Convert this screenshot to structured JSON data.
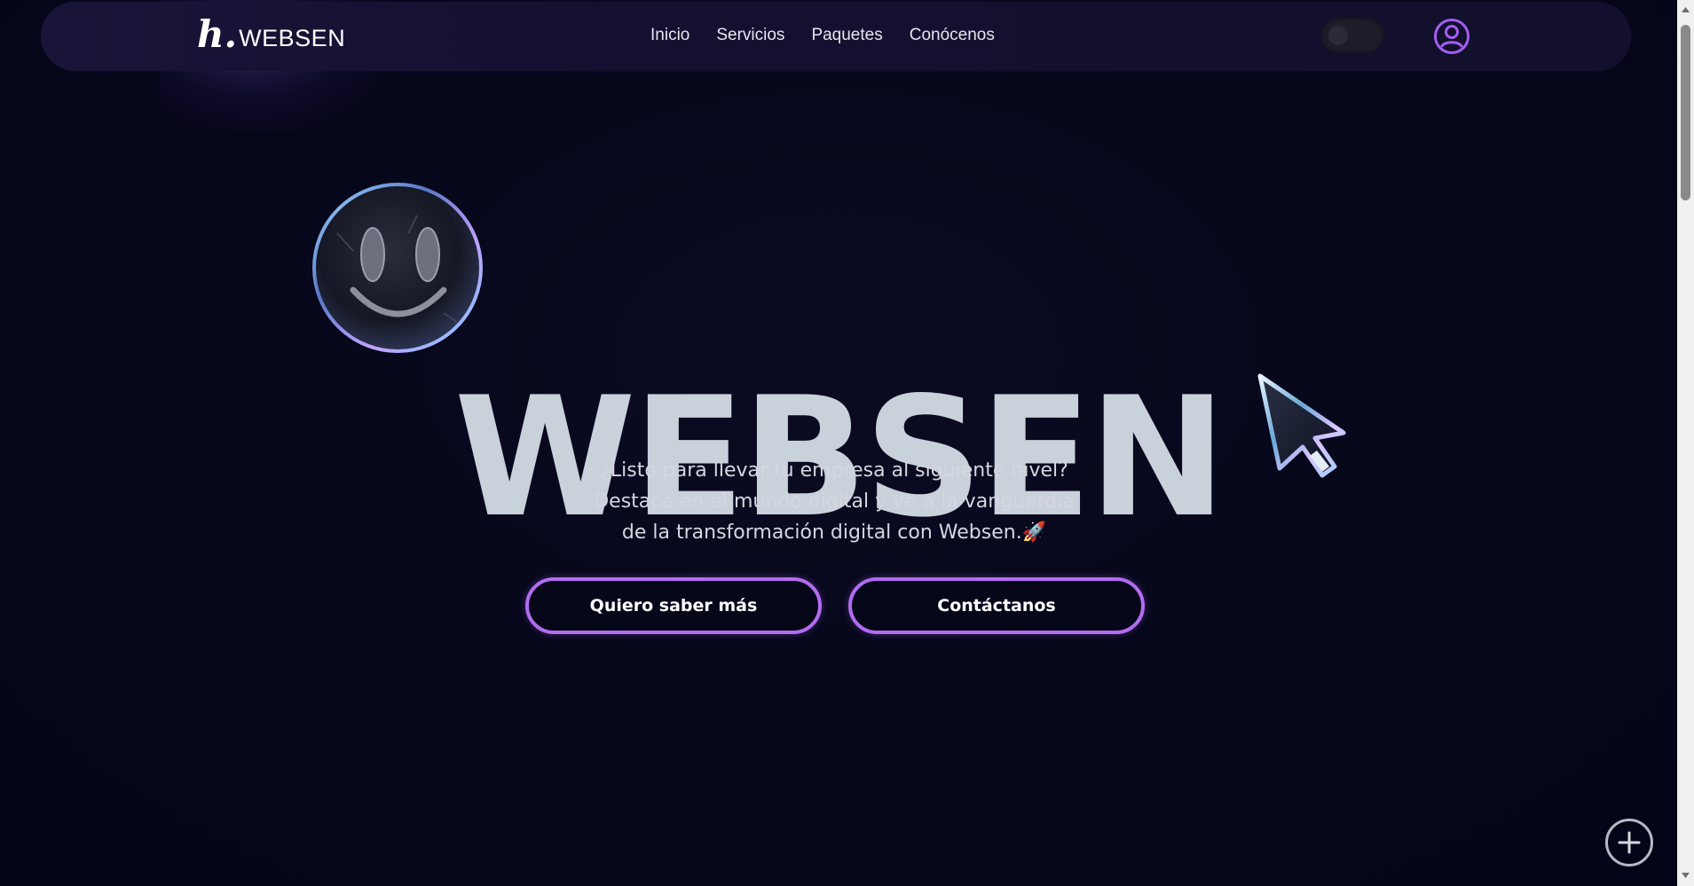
{
  "brand": {
    "mark": "h.",
    "name": "WEBSEN"
  },
  "nav": {
    "links": [
      "Inicio",
      "Servicios",
      "Paquetes",
      "Conócenos"
    ]
  },
  "hero": {
    "title": "WEBSEN",
    "tagline": [
      "¿Listo para llevar tu empresa al siguiente nivel?",
      "Destaca en el mundo digital y ve a la vanguardia",
      "de la transformación digital con Websen.🚀"
    ],
    "buttons": {
      "primary": "Quiero saber más",
      "secondary": "Contáctanos"
    }
  },
  "icons": {
    "theme_toggle": "moon-icon",
    "user": "user-circle-icon",
    "fab": "plus-icon",
    "decor_1": "smiley-bubble",
    "decor_2": "cursor-arrow"
  },
  "colors": {
    "background": "#07071a",
    "navbar": "#16122f",
    "accent": "#b26cf0",
    "title": "#c9d1db"
  }
}
